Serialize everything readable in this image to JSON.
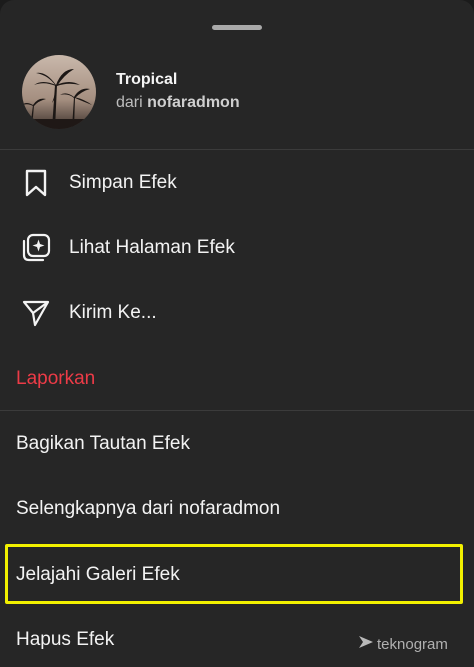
{
  "effect": {
    "name": "Tropical",
    "by_prefix": "dari",
    "author": "nofaradmon"
  },
  "menu": {
    "save": {
      "label": "Simpan Efek",
      "icon": "bookmark-icon"
    },
    "view_page": {
      "label": "Lihat Halaman Efek",
      "icon": "effect-page-icon"
    },
    "send": {
      "label": "Kirim Ke...",
      "icon": "send-icon"
    },
    "report": {
      "label": "Laporkan"
    },
    "share_link": {
      "label": "Bagikan Tautan Efek"
    },
    "more_from": {
      "label": "Selengkapnya dari nofaradmon"
    },
    "explore_gallery": {
      "label": "Jelajahi Galeri Efek"
    },
    "remove": {
      "label": "Hapus Efek"
    }
  },
  "watermark": {
    "text": "teknogram"
  },
  "colors": {
    "sheet_bg": "#262626",
    "report_red": "#ec3b47",
    "highlight_yellow": "#f2f000"
  }
}
